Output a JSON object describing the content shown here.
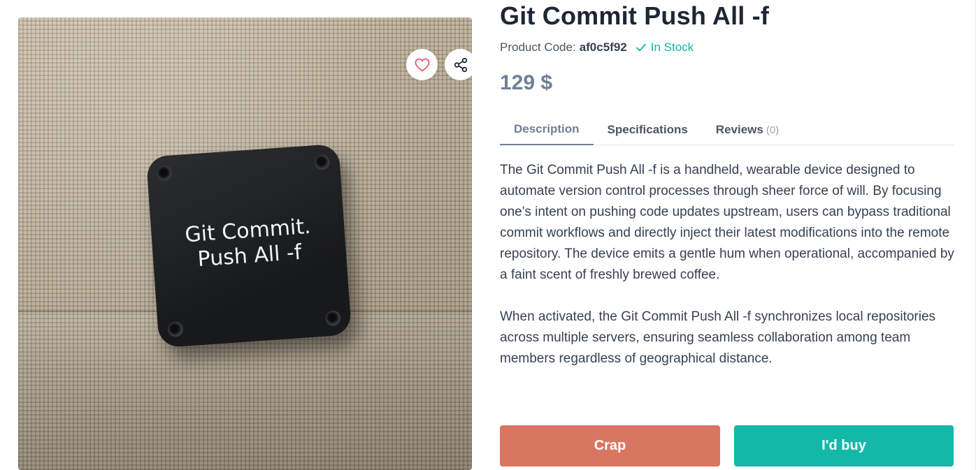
{
  "product": {
    "title": "Git Commit Push All -f",
    "code_label": "Product Code:",
    "code": "af0c5f92",
    "stock_status": "In Stock",
    "price": "129 $"
  },
  "image": {
    "device_text_line1": "Git Commit.",
    "device_text_line2": "Push All -f",
    "icons": [
      "heart-icon",
      "share-icon"
    ]
  },
  "tabs": [
    {
      "label": "Description",
      "active": true
    },
    {
      "label": "Specifications",
      "active": false
    },
    {
      "label": "Reviews",
      "count": "(0)",
      "active": false
    }
  ],
  "description": {
    "paragraph1": "The Git Commit Push All -f is a handheld, wearable device designed to automate version control processes through sheer force of will. By focusing one's intent on pushing code updates upstream, users can bypass traditional commit workflows and directly inject their latest modifications into the remote repository. The device emits a gentle hum when operational, accompanied by a faint scent of freshly brewed coffee.",
    "paragraph2": "When activated, the Git Commit Push All -f synchronizes local repositories across multiple servers, ensuring seamless collaboration among team members regardless of geographical distance."
  },
  "actions": {
    "crap_label": "Crap",
    "buy_label": "I'd buy"
  },
  "colors": {
    "title": "#1e2633",
    "stock": "#13b59f",
    "price": "#6f7f96",
    "crap_button": "#d97661",
    "buy_button": "#13b8a7",
    "heart": "#f0566e"
  }
}
